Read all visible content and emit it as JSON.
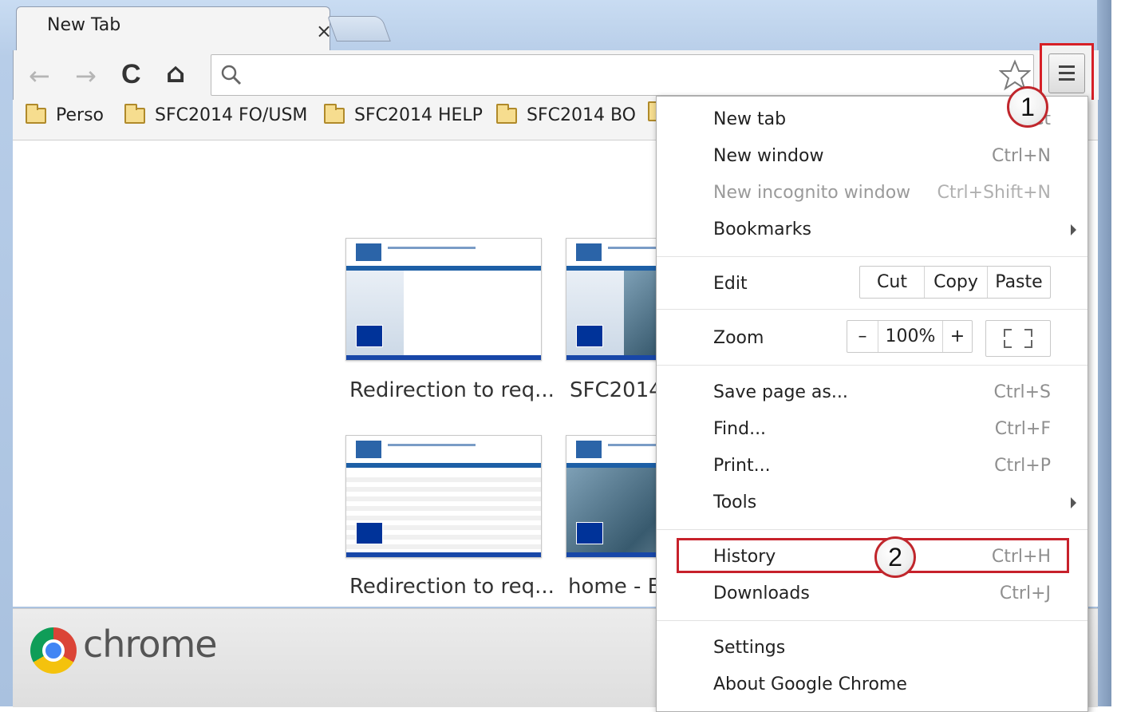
{
  "tab": {
    "title": "New Tab",
    "close": "×"
  },
  "nav": {
    "back": "←",
    "forward": "→",
    "reload": "C",
    "home": "⌂"
  },
  "omnibox": {
    "search_icon": "search-icon",
    "star_icon": "star-icon"
  },
  "bookmarks": [
    {
      "label": "Perso"
    },
    {
      "label": "SFC2014 FO/USM"
    },
    {
      "label": "SFC2014 HELP"
    },
    {
      "label": "SFC2014 BO"
    }
  ],
  "thumbnails": [
    {
      "caption": "Redirection to req..."
    },
    {
      "caption": "SFC2014"
    },
    {
      "caption": "Redirection to req..."
    },
    {
      "caption": "home - E"
    }
  ],
  "footer": {
    "brand": "chrome"
  },
  "menu": {
    "new_tab": {
      "label": "New tab",
      "shortcut": "Ct"
    },
    "new_window": {
      "label": "New window",
      "shortcut": "Ctrl+N"
    },
    "incognito": {
      "label": "New incognito window",
      "shortcut": "Ctrl+Shift+N"
    },
    "bookmarks": {
      "label": "Bookmarks"
    },
    "edit": {
      "label": "Edit",
      "cut": "Cut",
      "copy": "Copy",
      "paste": "Paste"
    },
    "zoom": {
      "label": "Zoom",
      "minus": "–",
      "value": "100%",
      "plus": "+"
    },
    "save_page": {
      "label": "Save page as...",
      "shortcut": "Ctrl+S"
    },
    "find": {
      "label": "Find...",
      "shortcut": "Ctrl+F"
    },
    "print": {
      "label": "Print...",
      "shortcut": "Ctrl+P"
    },
    "tools": {
      "label": "Tools"
    },
    "history": {
      "label": "History",
      "shortcut": "Ctrl+H"
    },
    "downloads": {
      "label": "Downloads",
      "shortcut": "Ctrl+J"
    },
    "settings": {
      "label": "Settings"
    },
    "about": {
      "label": "About Google Chrome"
    }
  },
  "callouts": {
    "first": "1",
    "second": "2"
  },
  "colors": {
    "annotation_red": "#c7212b",
    "eu_blue": "#003399"
  }
}
